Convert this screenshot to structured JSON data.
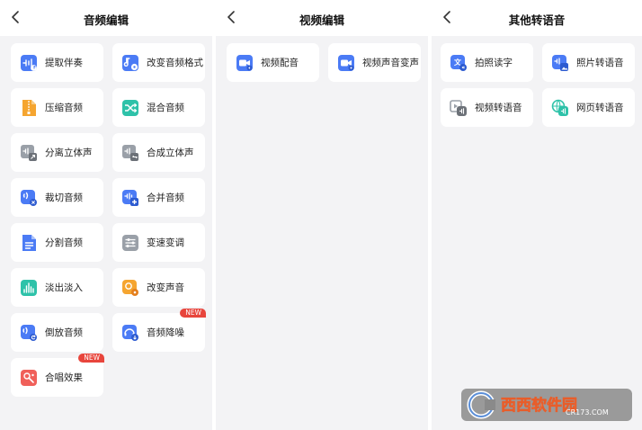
{
  "screens": [
    {
      "title": "音频编辑",
      "items": [
        {
          "label": "提取伴奏",
          "icon": "music-note-icon",
          "color": "#4b7bf5"
        },
        {
          "label": "改变音频格式",
          "icon": "music-disc-icon",
          "color": "#4b7bf5"
        },
        {
          "label": "压缩音频",
          "icon": "compress-file-icon",
          "color": "#f5a530"
        },
        {
          "label": "混合音频",
          "icon": "shuffle-icon",
          "color": "#2ec2a9"
        },
        {
          "label": "分离立体声",
          "icon": "split-stereo-icon",
          "color": "#9aa0a8"
        },
        {
          "label": "合成立体声",
          "icon": "merge-stereo-icon",
          "color": "#9aa0a8"
        },
        {
          "label": "裁切音频",
          "icon": "cut-audio-icon",
          "color": "#4b7bf5"
        },
        {
          "label": "合并音频",
          "icon": "merge-audio-icon",
          "color": "#4b7bf5"
        },
        {
          "label": "分割音频",
          "icon": "split-document-icon",
          "color": "#4b7bf5"
        },
        {
          "label": "变速变调",
          "icon": "sliders-icon",
          "color": "#9aa0a8"
        },
        {
          "label": "淡出淡入",
          "icon": "equalizer-icon",
          "color": "#2ec2a9"
        },
        {
          "label": "改变声音",
          "icon": "voice-change-icon",
          "color": "#f5a530"
        },
        {
          "label": "倒放音频",
          "icon": "reverse-audio-icon",
          "color": "#4b7bf5"
        },
        {
          "label": "音频降噪",
          "icon": "noise-reduction-icon",
          "color": "#4b7bf5",
          "badge": "NEW"
        },
        {
          "label": "合唱效果",
          "icon": "chorus-icon",
          "color": "#f0605a",
          "badge": "NEW"
        }
      ]
    },
    {
      "title": "视频编辑",
      "items": [
        {
          "label": "视频配音",
          "icon": "video-camera-icon",
          "color": "#4b7bf5"
        },
        {
          "label": "视频声音变声",
          "icon": "video-voice-icon",
          "color": "#4b7bf5"
        }
      ]
    },
    {
      "title": "其他转语音",
      "items": [
        {
          "label": "拍照读字",
          "icon": "text-photo-icon",
          "color": "#4b7bf5"
        },
        {
          "label": "照片转语音",
          "icon": "image-audio-icon",
          "color": "#4b7bf5"
        },
        {
          "label": "视频转语音",
          "icon": "video-to-audio-icon",
          "color": "#9aa0a8"
        },
        {
          "label": "网页转语音",
          "icon": "web-to-audio-icon",
          "color": "#2ec2a9"
        }
      ]
    }
  ],
  "watermark": {
    "brand": "西西软件园",
    "url": "CR173.COM",
    "icon": "cr-logo-icon"
  }
}
